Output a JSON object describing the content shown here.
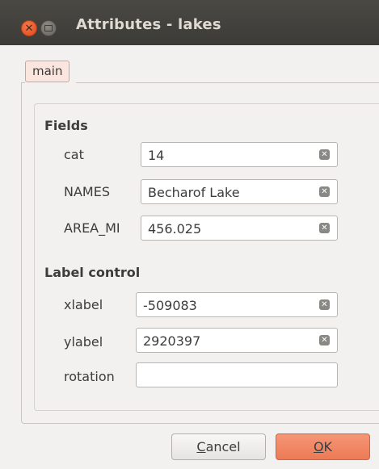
{
  "window": {
    "title": "Attributes - lakes"
  },
  "tabs": [
    {
      "label": "main",
      "selected": true
    }
  ],
  "fields_section": {
    "title": "Fields",
    "rows": [
      {
        "label": "cat",
        "value": "14"
      },
      {
        "label": "NAMES",
        "value": "Becharof Lake"
      },
      {
        "label": "AREA_MI",
        "value": "456.025"
      }
    ]
  },
  "label_control_section": {
    "title": "Label control",
    "rows": [
      {
        "label": "xlabel",
        "value": "-509083"
      },
      {
        "label": "ylabel",
        "value": "2920397"
      },
      {
        "label": "rotation",
        "value": ""
      }
    ]
  },
  "buttons": {
    "cancel": {
      "mnemonic": "C",
      "rest": "ancel"
    },
    "ok": {
      "mnemonic": "O",
      "rest": "K"
    }
  },
  "colors": {
    "titlebar": "#3c3b37",
    "close_button": "#e0461c",
    "selected_tab_bg": "#fbe6df",
    "ok_button": "#ec7a55"
  },
  "icons": {
    "window_close": "close-icon",
    "window_minimize": "minimize-icon",
    "field_clear": "clear-icon"
  }
}
